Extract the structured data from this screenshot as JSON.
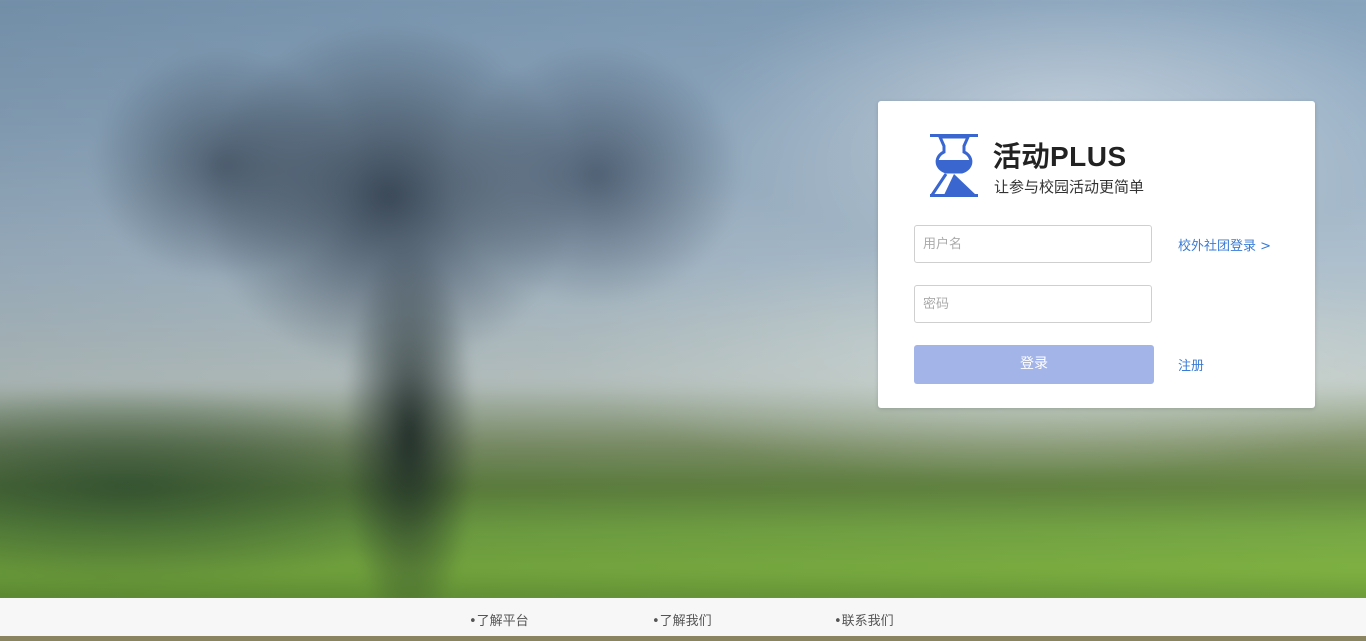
{
  "brand": {
    "title": "活动PLUS",
    "subtitle": "让参与校园活动更简单"
  },
  "login": {
    "username_placeholder": "用户名",
    "username_value": "",
    "password_placeholder": "密码",
    "password_value": "",
    "login_label": "登录",
    "external_login_label": "校外社团登录 >",
    "register_label": "注册"
  },
  "footer": {
    "links": [
      {
        "label": "•了解平台"
      },
      {
        "label": "•了解我们"
      },
      {
        "label": "•联系我们"
      }
    ]
  },
  "colors": {
    "accent": "#3a7bd5",
    "login_button": "#a3b4e9",
    "logo_blue": "#3a66d0"
  }
}
